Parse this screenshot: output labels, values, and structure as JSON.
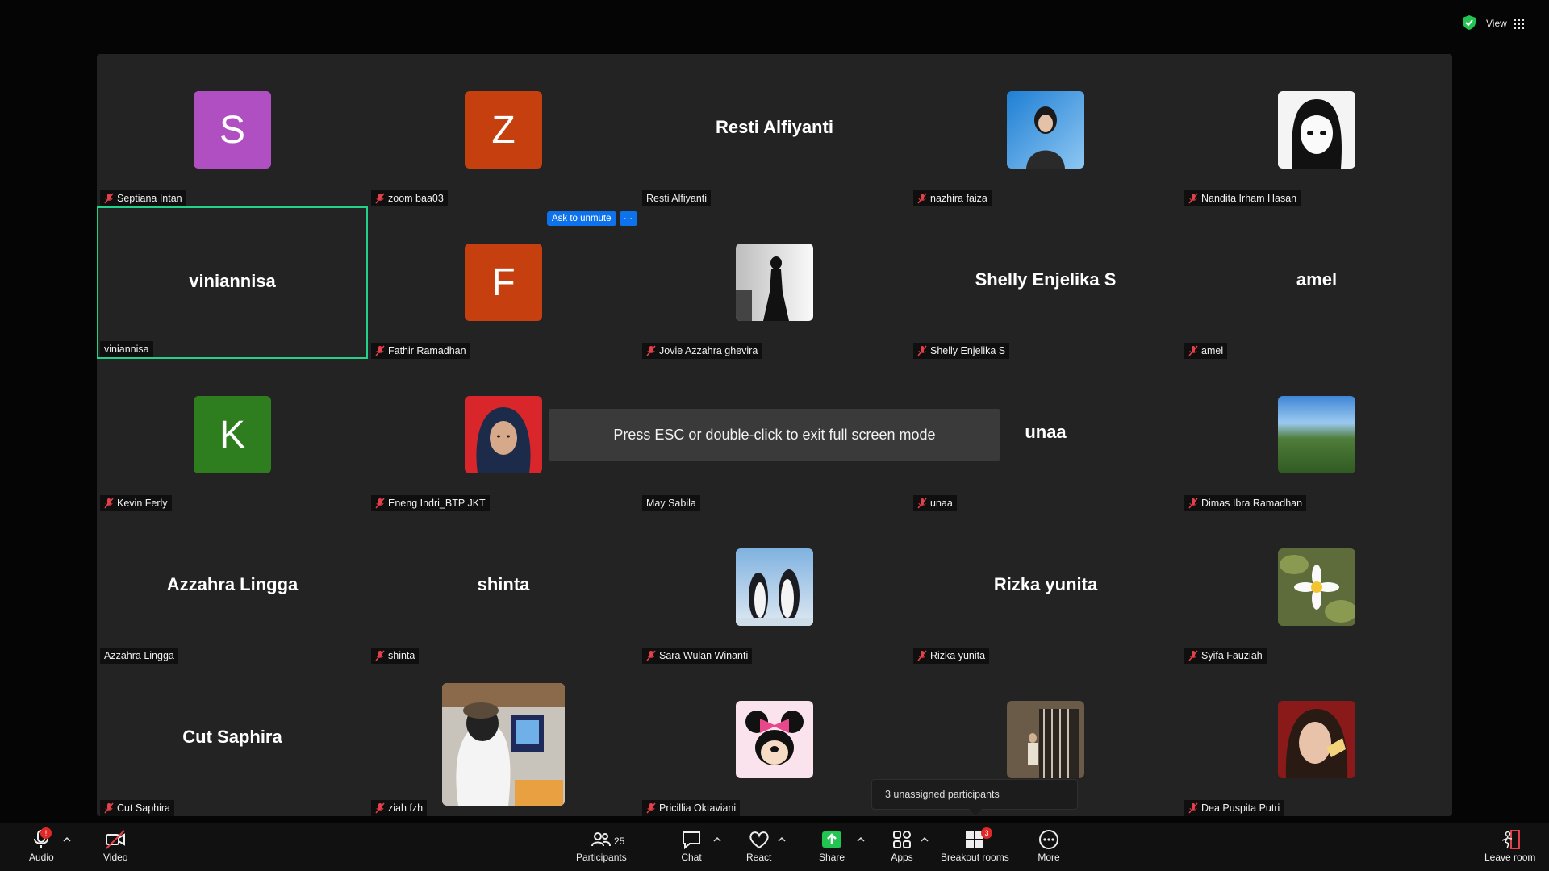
{
  "top": {
    "view_label": "View"
  },
  "gallery": {
    "tiles": [
      {
        "name": "Septiana Intan",
        "initial": "S",
        "color": "#b04fc1",
        "muted": true
      },
      {
        "name": "zoom baa03",
        "initial": "Z",
        "color": "#c5400e",
        "muted": true
      },
      {
        "name": "Resti Alfiyanti",
        "bigname": "Resti Alfiyanti",
        "muted": false
      },
      {
        "name": "nazhira faiza",
        "muted": true
      },
      {
        "name": "Nandita Irham Hasan",
        "muted": true
      },
      {
        "name": "viniannisa",
        "bigname": "viniannisa",
        "muted": false
      },
      {
        "name": "Fathir Ramadhan",
        "initial": "F",
        "color": "#c5400e",
        "muted": true
      },
      {
        "name": "Jovie Azzahra ghevira",
        "muted": true
      },
      {
        "name": "Shelly Enjelika S",
        "bigname": "Shelly Enjelika S",
        "muted": true
      },
      {
        "name": "amel",
        "bigname": "amel",
        "muted": true
      },
      {
        "name": "Kevin Ferly",
        "initial": "K",
        "color": "#2e7d1f",
        "muted": true
      },
      {
        "name": "Eneng Indri_BTP JKT",
        "muted": true
      },
      {
        "name": "May Sabila",
        "muted": false
      },
      {
        "name": "unaa",
        "bigname": "unaa",
        "muted": true
      },
      {
        "name": "Dimas Ibra Ramadhan",
        "muted": true
      },
      {
        "name": "Azzahra Lingga",
        "bigname": "Azzahra Lingga",
        "muted": false
      },
      {
        "name": "shinta",
        "bigname": "shinta",
        "muted": true
      },
      {
        "name": "Sara Wulan Winanti",
        "muted": true
      },
      {
        "name": "Rizka yunita",
        "bigname": "Rizka yunita",
        "muted": true
      },
      {
        "name": "Syifa Fauziah",
        "muted": true
      },
      {
        "name": "Cut Saphira",
        "bigname": "Cut Saphira",
        "muted": true
      },
      {
        "name": "ziah fzh",
        "muted": true
      },
      {
        "name": "Pricillia Oktaviani",
        "muted": true
      },
      {
        "name": "",
        "muted": false
      },
      {
        "name": "Dea Puspita Putri",
        "muted": true
      }
    ],
    "ask_to_unmute": "Ask to unmute",
    "more_dots": "···",
    "fullscreen_toast": "Press ESC or double-click to exit full screen mode",
    "unassigned": "3 unassigned participants"
  },
  "toolbar": {
    "audio": "Audio",
    "video": "Video",
    "participants": "Participants",
    "participants_count": "25",
    "chat": "Chat",
    "react": "React",
    "share": "Share",
    "apps": "Apps",
    "breakout": "Breakout rooms",
    "breakout_badge": "3",
    "more": "More",
    "leave": "Leave room",
    "audio_badge": "!"
  }
}
